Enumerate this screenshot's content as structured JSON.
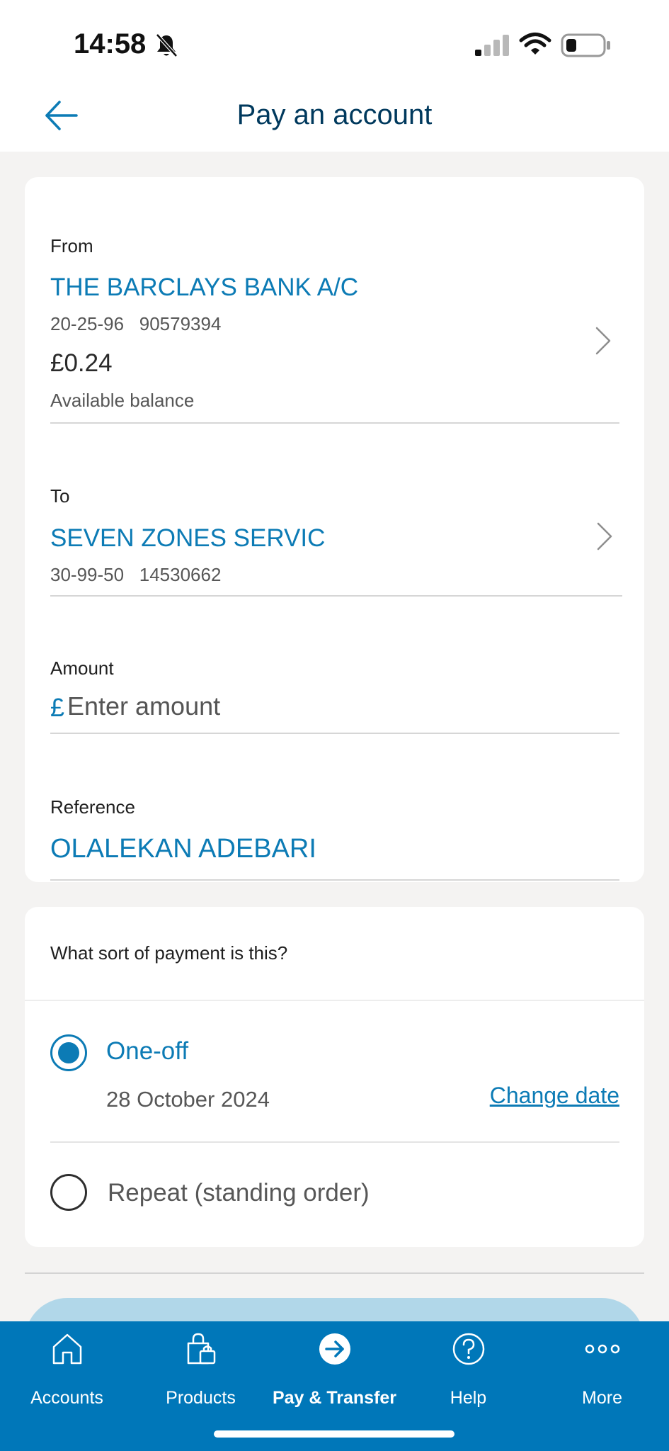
{
  "status_bar": {
    "time": "14:58"
  },
  "header": {
    "title": "Pay an account"
  },
  "from": {
    "label": "From",
    "account_name": "THE BARCLAYS BANK A/C",
    "sort_code": "20-25-96",
    "account_number": "90579394",
    "balance": "£0.24",
    "balance_label": "Available balance"
  },
  "to": {
    "label": "To",
    "payee_name": "SEVEN ZONES SERVIC",
    "sort_code": "30-99-50",
    "account_number": "14530662"
  },
  "amount": {
    "label": "Amount",
    "currency_symbol": "£",
    "placeholder": "Enter amount",
    "value": ""
  },
  "reference": {
    "label": "Reference",
    "value": "OLALEKAN ADEBARI"
  },
  "payment_type": {
    "question": "What sort of payment is this?",
    "options": [
      {
        "label": "One-off",
        "date": "28 October 2024",
        "selected": true
      },
      {
        "label": "Repeat (standing order)",
        "selected": false
      }
    ],
    "change_date_label": "Change date"
  },
  "colors": {
    "brand_blue": "#0077b9",
    "link_blue": "#0c7bb5",
    "title_navy": "#00395d"
  },
  "tab_bar": {
    "tabs": [
      {
        "label": "Accounts",
        "icon": "home-icon",
        "active": false
      },
      {
        "label": "Products",
        "icon": "shopping-bag-icon",
        "active": false
      },
      {
        "label": "Pay & Transfer",
        "icon": "arrow-circle-icon",
        "active": true
      },
      {
        "label": "Help",
        "icon": "question-circle-icon",
        "active": false
      },
      {
        "label": "More",
        "icon": "more-dots-icon",
        "active": false
      }
    ]
  }
}
